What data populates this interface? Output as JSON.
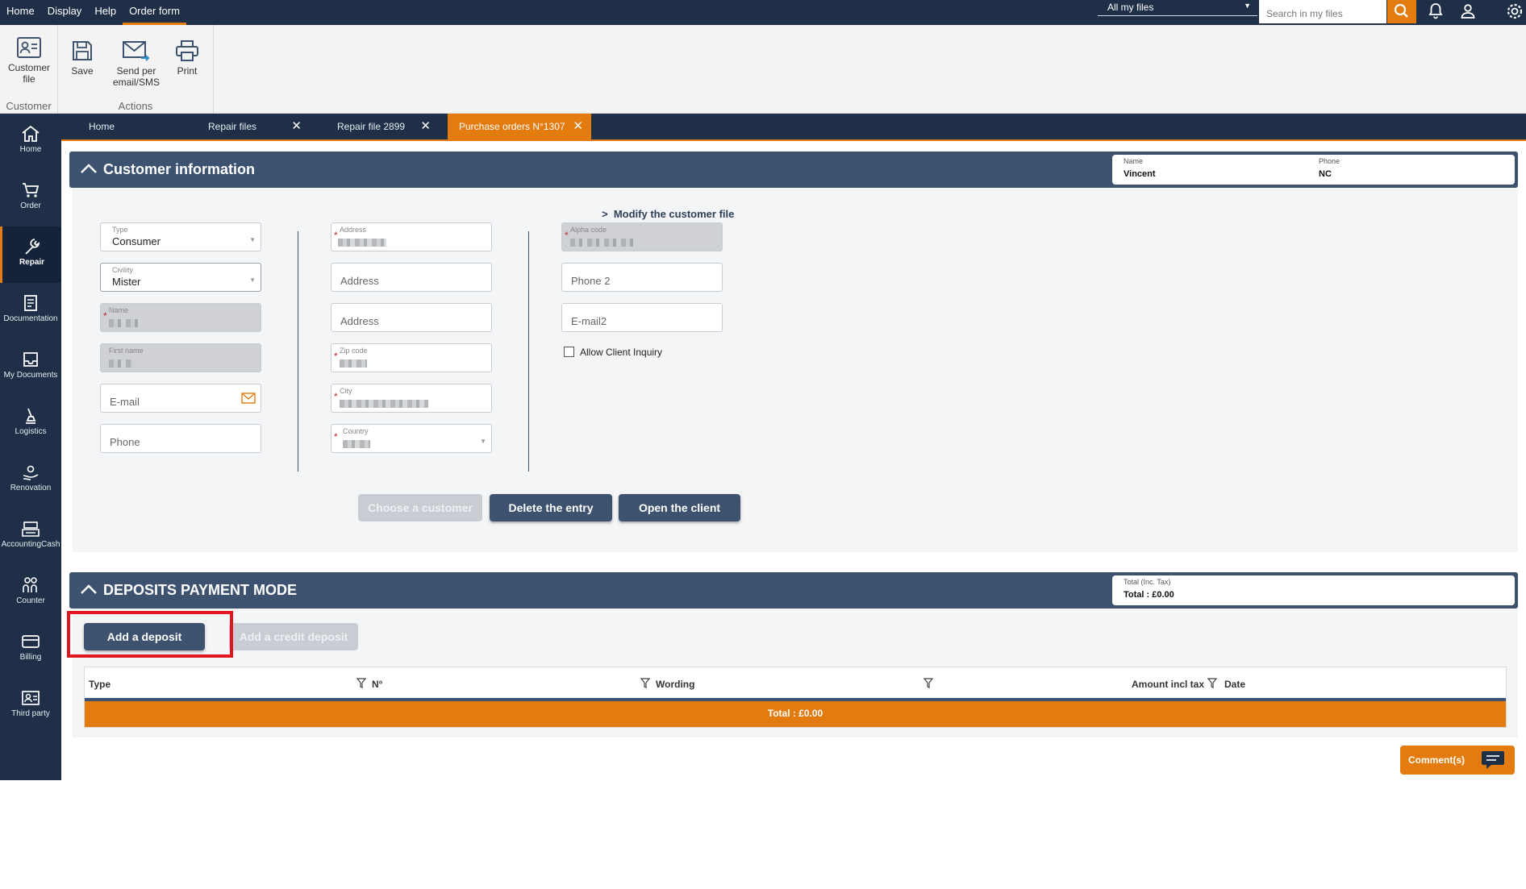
{
  "topbar": {
    "menu": [
      "Home",
      "Display",
      "Help",
      "Order form"
    ],
    "active_menu": "Order form",
    "files_filter": "All my files",
    "search_placeholder": "Search in my files"
  },
  "ribbon": {
    "customer_group": {
      "button_line1": "Customer",
      "button_line2": "file",
      "label": "Customer"
    },
    "actions_group": {
      "save": "Save",
      "send_line1": "Send per",
      "send_line2": "email/SMS",
      "print": "Print",
      "label": "Actions"
    }
  },
  "sidebar": {
    "items": [
      {
        "label": "Home",
        "icon": "home-icon"
      },
      {
        "label": "Order",
        "icon": "cart-icon"
      },
      {
        "label": "Repair",
        "icon": "wrench-icon"
      },
      {
        "label": "Documentation",
        "icon": "document-icon"
      },
      {
        "label": "My Documents",
        "icon": "inbox-icon"
      },
      {
        "label": "Logistics",
        "icon": "logistics-icon"
      },
      {
        "label": "Renovation",
        "icon": "renovation-icon"
      },
      {
        "label": "AccountingCash",
        "icon": "cash-register-icon"
      },
      {
        "label": "Counter",
        "icon": "people-icon"
      },
      {
        "label": "Billing",
        "icon": "card-icon"
      },
      {
        "label": "Third party",
        "icon": "id-card-icon"
      }
    ],
    "active": "Repair"
  },
  "tabs": [
    {
      "label": "Home",
      "closable": false
    },
    {
      "label": "Repair files",
      "closable": true
    },
    {
      "label": "Repair file 2899",
      "closable": true
    },
    {
      "label": "Purchase orders N°1307",
      "closable": true,
      "active": true
    }
  ],
  "customer_section": {
    "title": "Customer information",
    "info_name_label": "Name",
    "info_name_value": "Vincent",
    "info_phone_label": "Phone",
    "info_phone_value": "NC",
    "modify_link": "Modify the customer file",
    "col1": {
      "type_label": "Type",
      "type_value": "Consumer",
      "civility_label": "Civility",
      "civility_value": "Mister",
      "name_label": "Name",
      "first_name_label": "First name",
      "email_placeholder": "E-mail",
      "phone_placeholder": "Phone"
    },
    "col2": {
      "address_label": "Address",
      "address2_placeholder": "Address",
      "address3_placeholder": "Address",
      "zip_label": "Zip code",
      "city_label": "City",
      "country_label": "Country"
    },
    "col3": {
      "alpha_label": "Alpha code",
      "phone2_placeholder": "Phone 2",
      "email2_placeholder": "E-mail2",
      "allow_inquiry_label": "Allow Client Inquiry"
    },
    "buttons": {
      "choose": "Choose a customer",
      "delete": "Delete the entry",
      "open": "Open the client"
    }
  },
  "deposits_section": {
    "title": "DEPOSITS PAYMENT MODE",
    "total_label": "Total (Inc. Tax)",
    "total_value": "Total : £0.00",
    "add_deposit": "Add a deposit",
    "add_credit_deposit": "Add a credit deposit",
    "columns": [
      "Type",
      "N°",
      "Wording",
      "Amount incl tax",
      "Date"
    ],
    "footer_total": "Total : £0.00"
  },
  "comments_button": "Comment(s)",
  "colors": {
    "navy": "#1e2f47",
    "section": "#3d526e",
    "accent": "#e47b0e",
    "highlight": "#e0151f"
  }
}
